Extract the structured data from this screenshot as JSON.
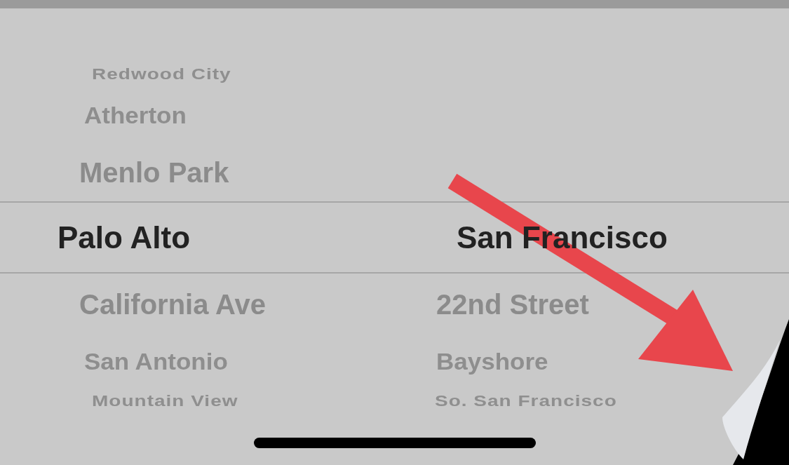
{
  "wheels": [
    {
      "items": [
        {
          "label": "Redwood City",
          "selected": false
        },
        {
          "label": "Atherton",
          "selected": false
        },
        {
          "label": "Menlo Park",
          "selected": false
        },
        {
          "label": "Palo Alto",
          "selected": true
        },
        {
          "label": "California Ave",
          "selected": false
        },
        {
          "label": "San Antonio",
          "selected": false
        },
        {
          "label": "Mountain View",
          "selected": false
        }
      ]
    },
    {
      "items": [
        {
          "label": "San Francisco",
          "selected": true
        },
        {
          "label": "22nd Street",
          "selected": false
        },
        {
          "label": "Bayshore",
          "selected": false
        },
        {
          "label": "So. San Francisco",
          "selected": false
        }
      ]
    }
  ]
}
